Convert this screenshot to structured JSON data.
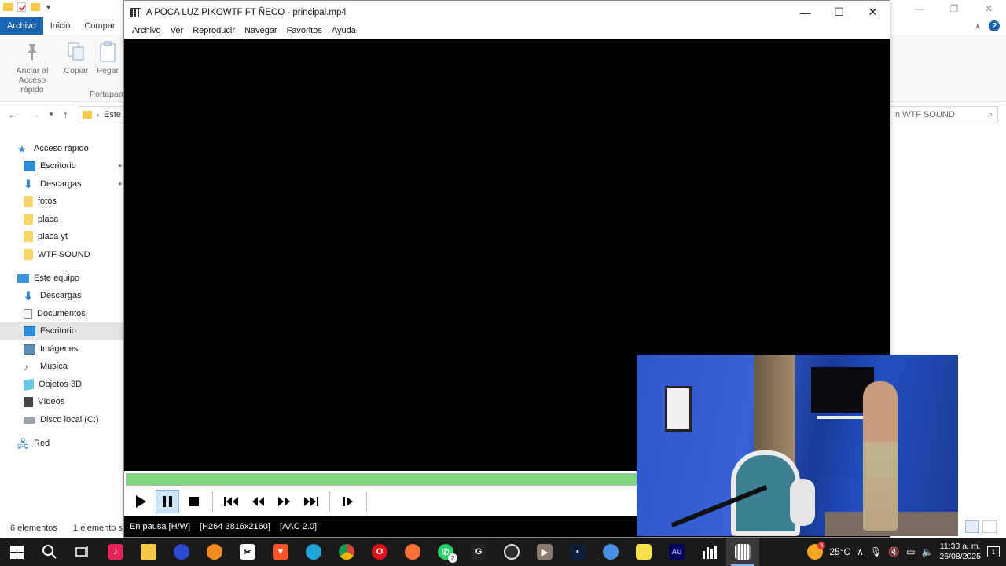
{
  "explorer": {
    "ribbon_tabs": [
      "Archivo",
      "Inicio",
      "Compar"
    ],
    "buttons": {
      "pin": "Anclar al\nAcceso rápido",
      "copy": "Copiar",
      "paste": "Pegar"
    },
    "group_label": "Portapap",
    "address": "Este",
    "search_placeholder": "n WTF SOUND",
    "nav": {
      "quick_access": "Acceso rápido",
      "desktop": "Escritorio",
      "downloads": "Descargas",
      "fotos": "fotos",
      "placa": "placa",
      "placa_yt": "placa yt",
      "wtf_sound": "WTF SOUND",
      "this_pc": "Este equipo",
      "pc_downloads": "Descargas",
      "documents": "Documentos",
      "pc_desktop": "Escritorio",
      "images": "Imágenes",
      "music": "Música",
      "objects3d": "Objetos 3D",
      "videos": "Vídeos",
      "local_disk": "Disco local (C:)",
      "network": "Red"
    },
    "status": {
      "count": "6 elementos",
      "selected": "1 elemento s"
    }
  },
  "player": {
    "title": "A POCA LUZ PIKOWTF FT ÑECO - principal.mp4",
    "menu": [
      "Archivo",
      "Ver",
      "Reproducir",
      "Navegar",
      "Favoritos",
      "Ayuda"
    ],
    "seek_progress_fraction": 1.0,
    "status": {
      "state": "En pausa [H/W]",
      "video": "[H264 3816x2160]",
      "audio": "[AAC 2.0]"
    }
  },
  "taskbar": {
    "whatsapp_badge": "2",
    "weather_badge": "5",
    "temperature": "25°C",
    "time": "11:33 a. m.",
    "date": "26/08/2025",
    "notifications": "1"
  },
  "colors": {
    "seek_fill": "#7fd67f",
    "ribbon_file_tab": "#1a64b4",
    "taskbar_bg": "#1a1a1a"
  }
}
